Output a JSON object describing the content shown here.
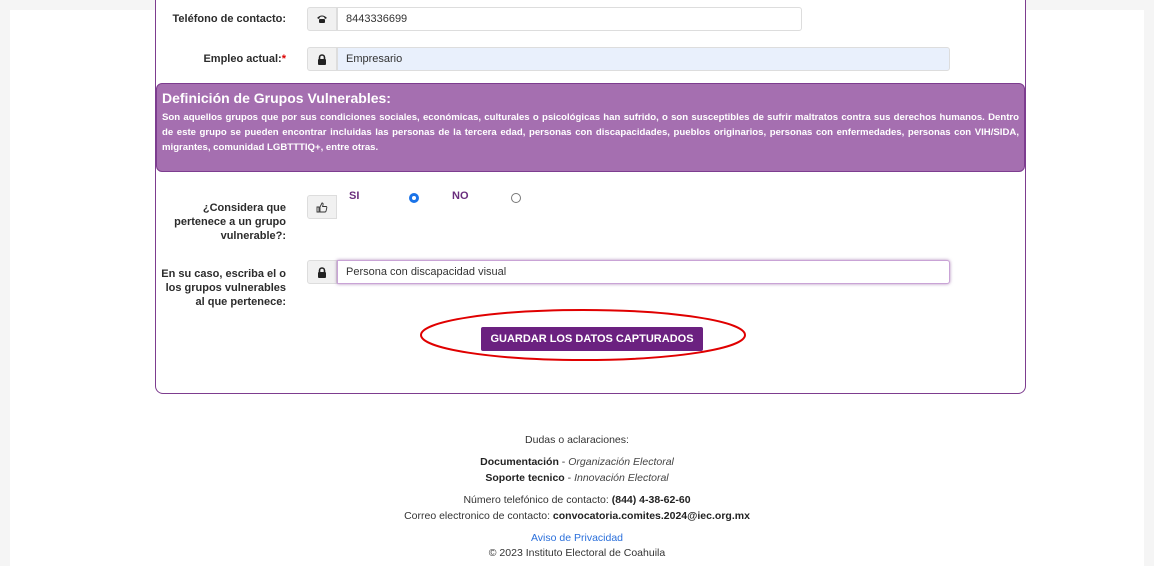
{
  "form": {
    "phone": {
      "label": "Teléfono de contacto:",
      "value": "8443336699",
      "icon": "phone-icon"
    },
    "job": {
      "label": "Empleo actual:",
      "required_mark": "*",
      "value": "Empresario",
      "icon": "lock-icon"
    },
    "vulnerable_info": {
      "title": "Definición de Grupos Vulnerables:",
      "text": "Son aquellos grupos que por sus condiciones sociales, económicas, culturales o psicológicas han sufrido, o son susceptibles de sufrir maltratos contra sus derechos humanos. Dentro de este grupo se pueden encontrar incluidas las personas de la tercera edad, personas con discapacidades, pueblos originarios, personas con enfermedades, personas con VIH/SIDA, migrantes, comunidad LGBTTTIQ+, entre otras."
    },
    "vulnerable_question": {
      "label": "¿Considera que pertenece a un grupo vulnerable?:",
      "icon": "thumbs-up-icon",
      "options": [
        {
          "label": "SI",
          "selected": true
        },
        {
          "label": "NO",
          "selected": false
        }
      ]
    },
    "vulnerable_groups": {
      "label": "En su caso, escriba el o los grupos vulnerables al que pertenece:",
      "value": "Persona con discapacidad visual",
      "icon": "lock-icon"
    },
    "save_button": "GUARDAR LOS DATOS CAPTURADOS"
  },
  "footer": {
    "doubts": "Dudas o aclaraciones:",
    "documentation_label": "Documentación",
    "documentation_area": "Organización Electoral",
    "support_label": "Soporte tecnico",
    "support_area": "Innovación Electoral",
    "phone_label": "Número telefónico de contacto:",
    "phone_value": "(844) 4-38-62-60",
    "email_label": "Correo electronico de contacto:",
    "email_value": "convocatoria.comites.2024@iec.org.mx",
    "privacy": "Aviso de Privacidad",
    "copyright": "© 2023 Instituto Electoral de Coahuila"
  },
  "colors": {
    "accent": "#6b2180",
    "info_box": "#a56fb0",
    "radio_selected": "#1a73e8",
    "highlight_ellipse": "#e00000"
  }
}
